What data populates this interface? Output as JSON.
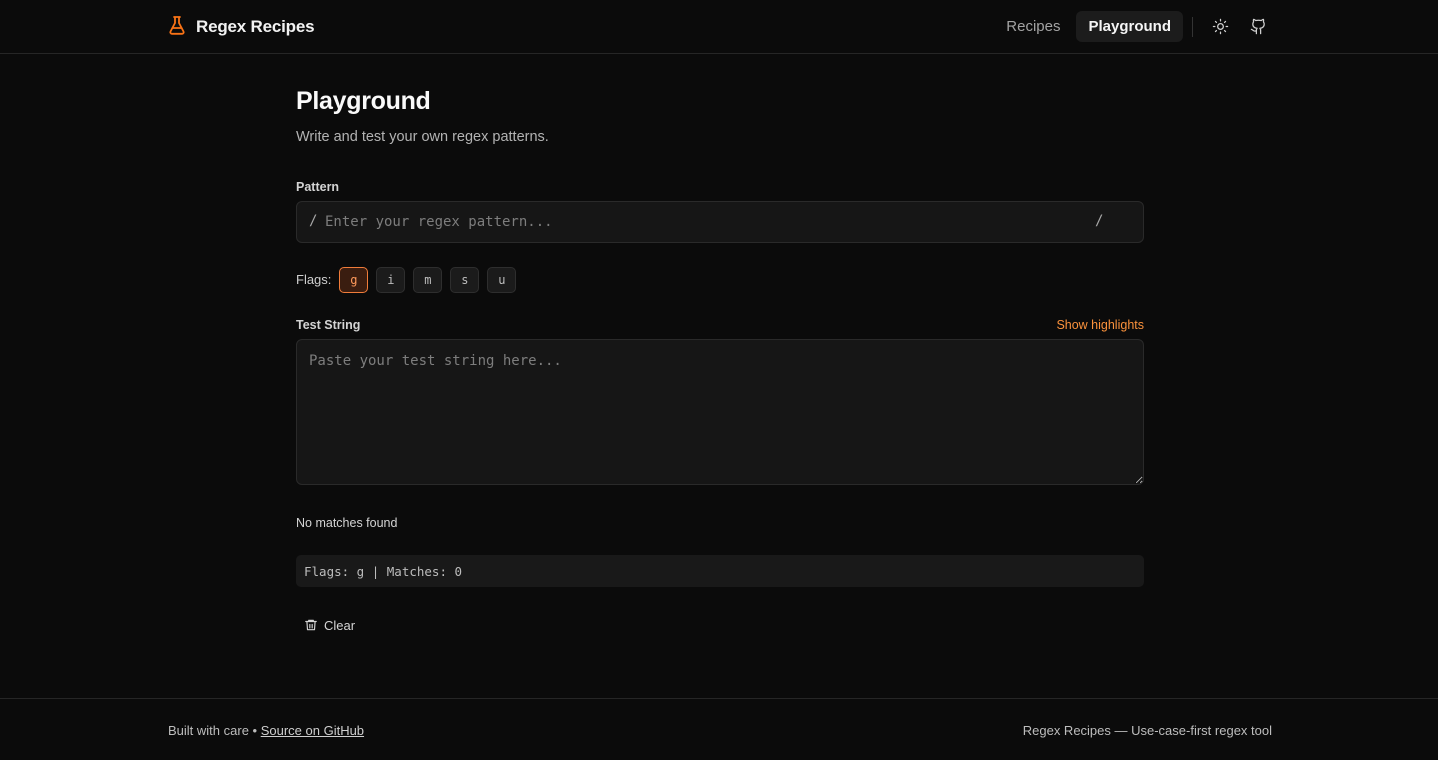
{
  "header": {
    "brand_title": "Regex Recipes",
    "nav": {
      "recipes": "Recipes",
      "playground": "Playground"
    },
    "accent_color": "#f97316"
  },
  "main": {
    "title": "Playground",
    "subtitle": "Write and test your own regex patterns.",
    "pattern": {
      "label": "Pattern",
      "left_delimiter": "/",
      "right_delimiter": "/",
      "value": "",
      "placeholder": "Enter your regex pattern..."
    },
    "flags": {
      "label": "Flags:",
      "items": [
        {
          "label": "g",
          "active": true
        },
        {
          "label": "i",
          "active": false
        },
        {
          "label": "m",
          "active": false
        },
        {
          "label": "s",
          "active": false
        },
        {
          "label": "u",
          "active": false
        }
      ]
    },
    "test_string": {
      "label": "Test String",
      "toggle_label": "Show highlights",
      "value": "",
      "placeholder": "Paste your test string here..."
    },
    "result_text": "No matches found",
    "summary": "Flags: g | Matches: 0",
    "clear_label": "Clear"
  },
  "footer": {
    "left_text": "Built with care • ",
    "left_link": "Source on GitHub",
    "right_text": "Regex Recipes — Use-case-first regex tool"
  },
  "icons": {
    "brand": "flask-icon",
    "theme": "sun-icon",
    "github": "github-icon",
    "clear": "trash-icon"
  }
}
